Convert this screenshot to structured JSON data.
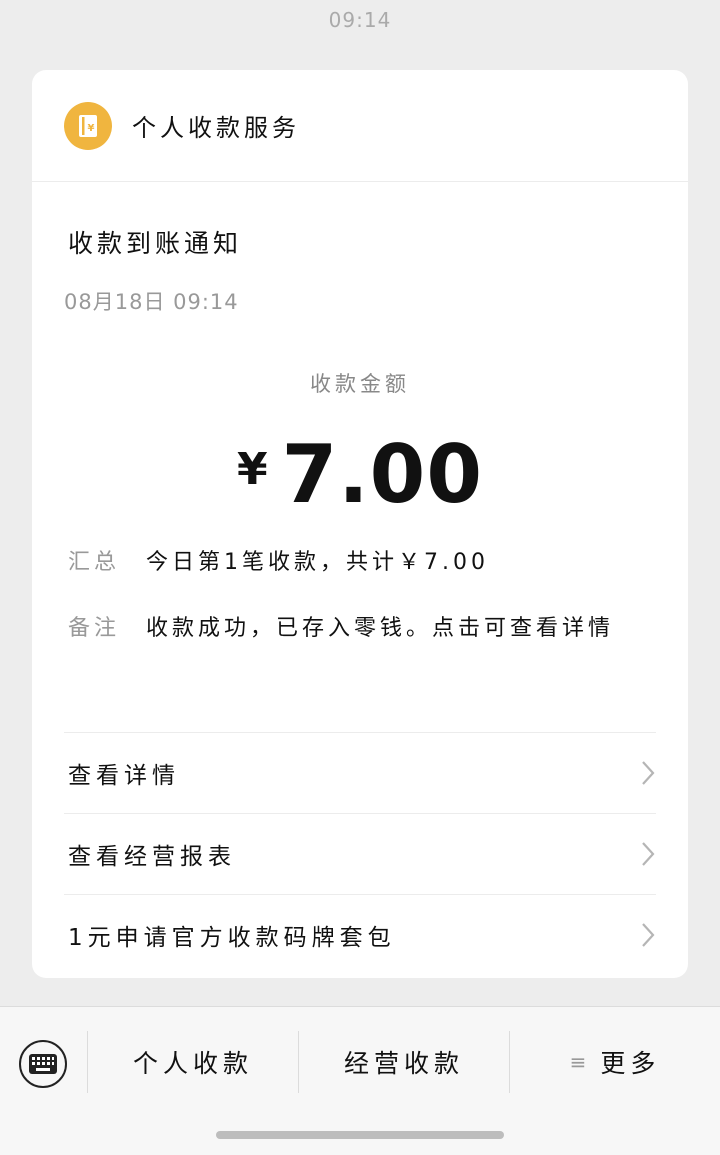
{
  "status_bar": {
    "time": "09:14"
  },
  "card": {
    "service_name": "个人收款服务",
    "notice_title": "收款到账通知",
    "notice_time": "08月18日 09:14",
    "amount_label": "收款金额",
    "currency": "¥",
    "amount": "7.00",
    "summary": {
      "key": "汇总",
      "value": "今日第1笔收款，共计￥7.00"
    },
    "remark": {
      "key": "备注",
      "value": "收款成功，已存入零钱。点击可查看详情"
    },
    "links": [
      {
        "label": "查看详情"
      },
      {
        "label": "查看经营报表"
      },
      {
        "label": "1元申请官方收款码牌套包"
      }
    ]
  },
  "bottom_bar": {
    "menu_1": "个人收款",
    "menu_2": "经营收款",
    "menu_3": "更多"
  },
  "colors": {
    "accent": "#f0b53f",
    "background": "#ededed"
  }
}
